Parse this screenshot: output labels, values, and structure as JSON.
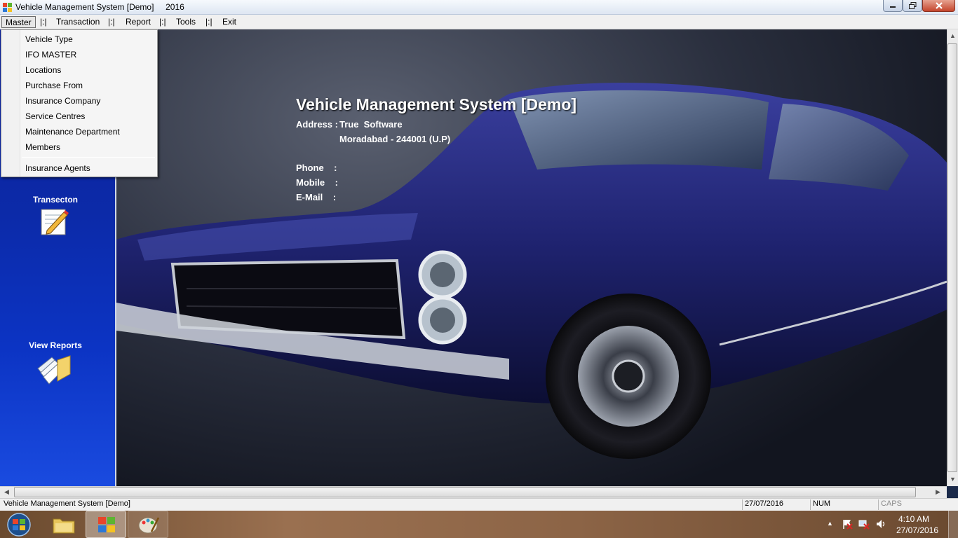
{
  "window": {
    "title": "Vehicle Management System [Demo]     2016"
  },
  "menu": {
    "items": [
      "Master",
      "|:|",
      "Transaction",
      "|:|",
      "Report",
      "|:|",
      "Tools",
      "|:|",
      "Exit"
    ]
  },
  "dropdown": {
    "items": [
      "Vehicle Type",
      "IFO MASTER",
      "Locations",
      "Purchase From",
      "Insurance Company",
      "Service Centres",
      "Maintenance Department",
      "Members"
    ],
    "after_separator": "Insurance Agents"
  },
  "left_panel": {
    "transaction_label": "Transecton",
    "reports_label": "View Reports"
  },
  "info": {
    "title": "Vehicle Management System [Demo]",
    "address_label": "Address : ",
    "address_line1": "True  Software",
    "address_line2": "Moradabad - 244001 (U.P)",
    "phone_label": "Phone    :",
    "mobile_label": "Mobile    :",
    "email_label": "E-Mail    :"
  },
  "statusbar": {
    "message": "Vehicle Management System [Demo]",
    "date": "27/07/2016",
    "num": "NUM",
    "caps": "CAPS"
  },
  "taskbar": {
    "time": "4:10 AM",
    "date": "27/07/2016"
  },
  "icons": [
    "app-icon",
    "minimize-icon",
    "maximize-icon",
    "close-icon",
    "edit-document-icon",
    "reports-folder-icon",
    "start-orb-icon",
    "explorer-icon",
    "paint-icon",
    "flag-icon",
    "network-icon",
    "volume-icon"
  ]
}
